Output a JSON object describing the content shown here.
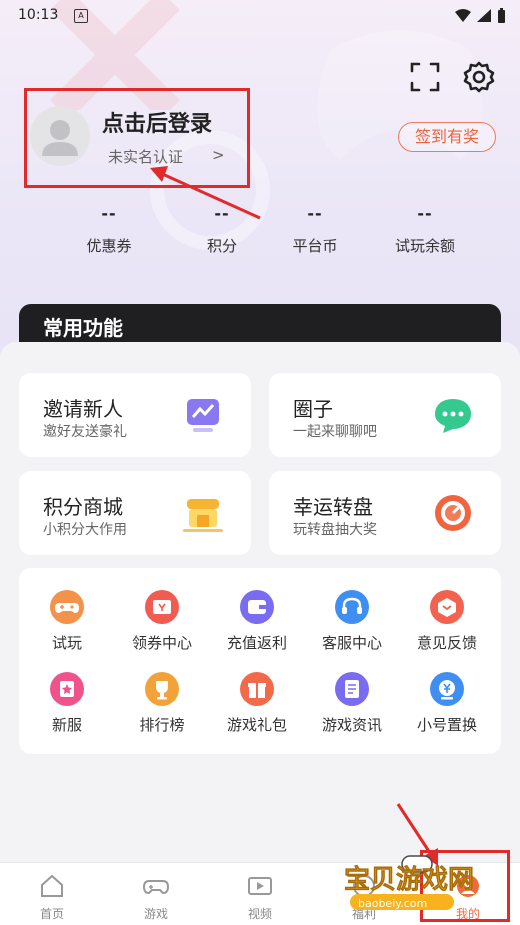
{
  "status": {
    "time": "10:13",
    "notif_badge": "A"
  },
  "profile": {
    "title": "点击后登录",
    "subtitle": "未实名认证",
    "chevron": ">",
    "signin_label": "签到有奖"
  },
  "stats": [
    {
      "value": "--",
      "label": "优惠券"
    },
    {
      "value": "--",
      "label": "积分"
    },
    {
      "value": "--",
      "label": "平台币"
    },
    {
      "value": "--",
      "label": "试玩余额"
    }
  ],
  "section_title": "常用功能",
  "cards": [
    {
      "title": "邀请新人",
      "subtitle": "邀好友送豪礼",
      "icon": "chart-card-icon"
    },
    {
      "title": "圈子",
      "subtitle": "一起来聊聊吧",
      "icon": "chat-bubble-icon"
    },
    {
      "title": "积分商城",
      "subtitle": "小积分大作用",
      "icon": "store-icon"
    },
    {
      "title": "幸运转盘",
      "subtitle": "玩转盘抽大奖",
      "icon": "wheel-icon"
    }
  ],
  "features": [
    {
      "label": "试玩",
      "icon": "gamepad-icon",
      "color": "#f3924a"
    },
    {
      "label": "领券中心",
      "icon": "ticket-icon",
      "color": "#f25b4f"
    },
    {
      "label": "充值返利",
      "icon": "wallet-icon",
      "color": "#7a6cf0"
    },
    {
      "label": "客服中心",
      "icon": "headset-icon",
      "color": "#3f8ff2"
    },
    {
      "label": "意见反馈",
      "icon": "feedback-icon",
      "color": "#f2624f"
    },
    {
      "label": "新服",
      "icon": "new-server-icon",
      "color": "#f0528a"
    },
    {
      "label": "排行榜",
      "icon": "trophy-icon",
      "color": "#f3a23a"
    },
    {
      "label": "游戏礼包",
      "icon": "gift-icon",
      "color": "#f36a4a"
    },
    {
      "label": "游戏资讯",
      "icon": "news-icon",
      "color": "#7a6cf0"
    },
    {
      "label": "小号置换",
      "icon": "exchange-icon",
      "color": "#3f8ff2"
    }
  ],
  "tabs": [
    {
      "label": "首页",
      "icon": "home-icon"
    },
    {
      "label": "游戏",
      "icon": "gamepad-icon"
    },
    {
      "label": "视频",
      "icon": "video-icon"
    },
    {
      "label": "福利",
      "icon": "welfare-icon"
    },
    {
      "label": "我的",
      "icon": "profile-icon",
      "active": true
    }
  ],
  "watermark": {
    "text": "宝贝游戏网",
    "url": "baobeiy.com"
  },
  "colors": {
    "accent": "#f0623c",
    "highlight_box": "#e12a2a",
    "dark_card": "#1f1f22"
  }
}
